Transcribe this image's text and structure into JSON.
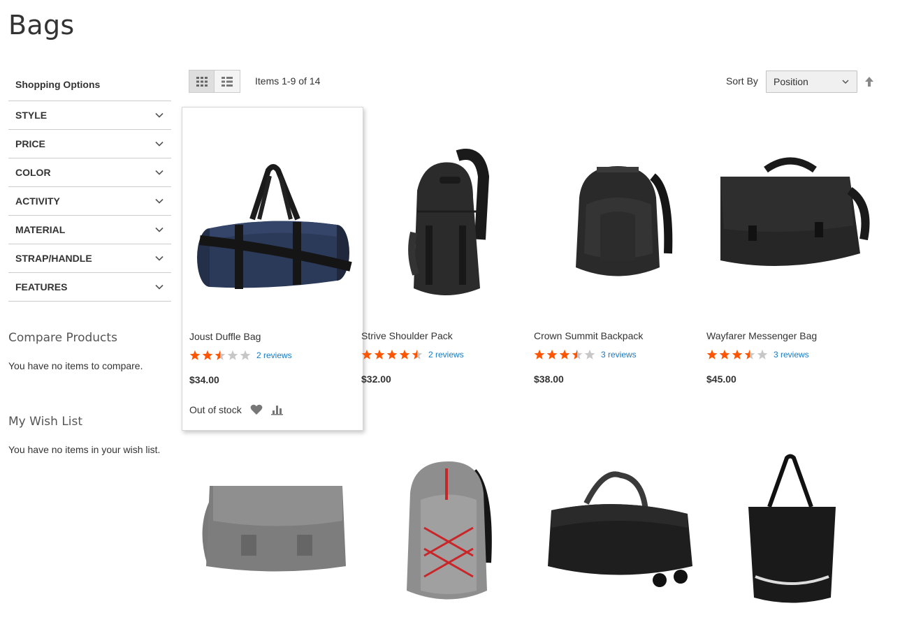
{
  "page": {
    "title": "Bags"
  },
  "sidebar": {
    "shopping_options": "Shopping Options",
    "filters": [
      "STYLE",
      "PRICE",
      "COLOR",
      "ACTIVITY",
      "MATERIAL",
      "STRAP/HANDLE",
      "FEATURES"
    ],
    "compare": {
      "title": "Compare Products",
      "text": "You have no items to compare."
    },
    "wishlist": {
      "title": "My Wish List",
      "text": "You have no items in your wish list."
    }
  },
  "toolbar": {
    "items_count": "Items 1-9 of 14",
    "sort_label": "Sort By",
    "sort_value": "Position"
  },
  "products": [
    {
      "name": "Joust Duffle Bag",
      "rating": 2.5,
      "reviews": "2 reviews",
      "price": "$34.00",
      "stock": "Out of stock",
      "image": "duffle-bag-icon"
    },
    {
      "name": "Strive Shoulder Pack",
      "rating": 4.5,
      "reviews": "2 reviews",
      "price": "$32.00",
      "image": "sling-backpack-icon"
    },
    {
      "name": "Crown Summit Backpack",
      "rating": 3.5,
      "reviews": "3 reviews",
      "price": "$38.00",
      "image": "backpack-icon"
    },
    {
      "name": "Wayfarer Messenger Bag",
      "rating": 3.5,
      "reviews": "3 reviews",
      "price": "$45.00",
      "image": "messenger-bag-icon"
    },
    {
      "image": "gray-messenger-bag-icon"
    },
    {
      "image": "gray-backpack-icon"
    },
    {
      "image": "rolling-duffle-icon"
    },
    {
      "image": "tote-bag-icon"
    }
  ],
  "colors": {
    "star_on": "#ff5501",
    "star_off": "#c7c7c7",
    "link": "#1979c3"
  }
}
